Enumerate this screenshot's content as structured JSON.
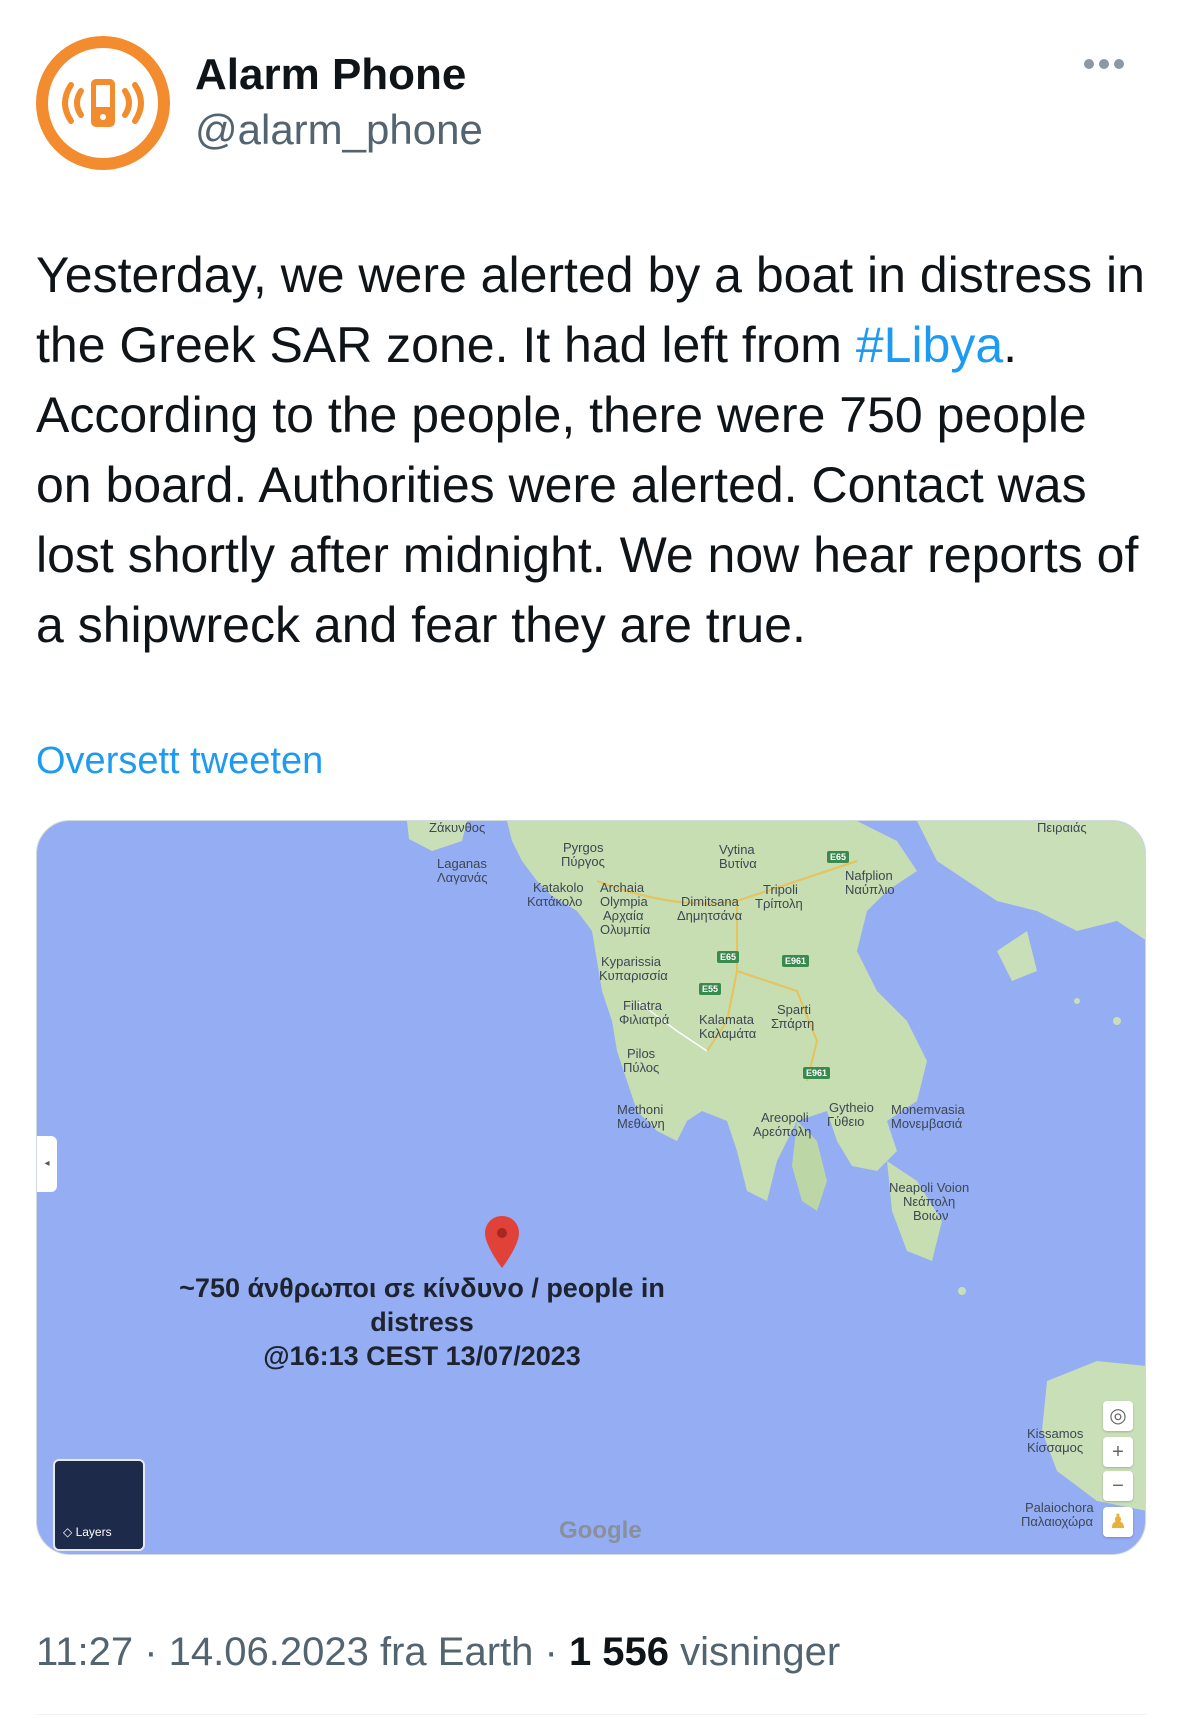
{
  "author": {
    "display_name": "Alarm Phone",
    "handle": "@alarm_phone",
    "brand_color": "#f28c2e"
  },
  "tweet": {
    "text_before": "Yesterday, we were alerted by a boat in distress in the Greek SAR zone. It had left from ",
    "hashtag": "#Libya",
    "text_after": ". According to the people, there were 750 people on board. Authorities were alerted. Contact was lost shortly after midnight. We now hear reports of a shipwreck and fear they are true.",
    "hashtag_color": "#1d9bf0"
  },
  "translate_label": "Oversett tweeten",
  "map": {
    "annotation_line1": "~750 άνθρωποι σε κίνδυνο / people in distress",
    "annotation_line2": "@16:13 CEST 13/07/2023",
    "layers_label": "Layers",
    "google_label": "Google",
    "zoom_in": "+",
    "zoom_out": "−",
    "places": {
      "zakynthos": "Ζάκυνθος",
      "laganas": "Laganas",
      "laganas_gr": "Λαγανάς",
      "pyrgos": "Pyrgos",
      "pyrgos_gr": "Πύργος",
      "vytina": "Vytina",
      "vytina_gr": "Βυτίνα",
      "katakolo": "Katakolo",
      "katakolo_gr": "Κατάκολο",
      "archaia": "Archaia",
      "olympia": "Olympia",
      "archaia_gr": "Αρχαία",
      "olympia_gr": "Ολυμπία",
      "dimitsana": "Dimitsana",
      "dimitsana_gr": "Δημητσάνα",
      "tripoli": "Tripoli",
      "tripoli_gr": "Τρίπολη",
      "nafplion": "Nafplion",
      "nafplion_gr": "Ναύπλιο",
      "peiraias_gr": "Πειραιάς",
      "kyparissia": "Kyparissia",
      "kyparissia_gr": "Κυπαρισσία",
      "filiatra": "Filiatra",
      "filiatra_gr": "Φιλιατρά",
      "kalamata": "Kalamata",
      "kalamata_gr": "Καλαμάτα",
      "sparti": "Sparti",
      "sparti_gr": "Σπάρτη",
      "pilos": "Pilos",
      "pilos_gr": "Πύλος",
      "methoni": "Methoni",
      "methoni_gr": "Μεθώνη",
      "areopoli": "Areopoli",
      "areopoli_gr": "Αρεόπολη",
      "gytheio": "Gytheio",
      "gytheio_gr": "Γύθειο",
      "monemvasia": "Monemvasia",
      "monemvasia_gr": "Μονεμβασιά",
      "neapoli": "Neapoli Voion",
      "neapoli_gr": "Νεάπολη",
      "voion_gr": "Βοιών",
      "kissamos": "Kissamos",
      "kissamos_gr": "Κίσσαμος",
      "palaiochora": "Palaiochora",
      "palaiochora_gr": "Παλαιοχώρα"
    },
    "roads": {
      "e65a": "E65",
      "e65b": "E65",
      "e55": "E55",
      "e961a": "E961",
      "e961b": "E961"
    }
  },
  "meta": {
    "time_date_source": "11:27 · 14.06.2023 fra Earth · ",
    "views_count": "1 556",
    "views_label": " visninger"
  }
}
